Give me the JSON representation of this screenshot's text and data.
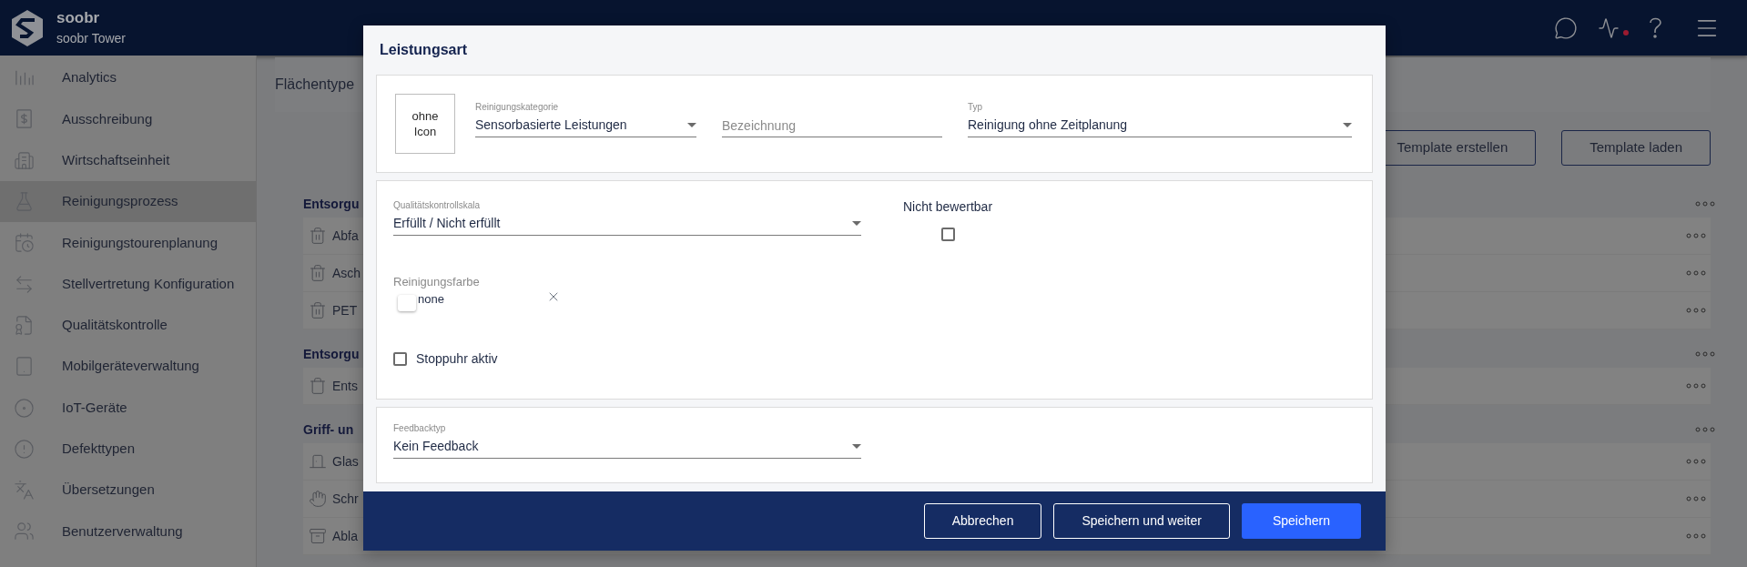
{
  "header": {
    "brand": "soobr",
    "site": "soobr Tower"
  },
  "sidebar": {
    "items": [
      {
        "label": "Analytics",
        "selected": false
      },
      {
        "label": "Ausschreibung",
        "selected": false
      },
      {
        "label": "Wirtschaftseinheit",
        "selected": false
      },
      {
        "label": "Reinigungsprozess",
        "selected": true
      },
      {
        "label": "Reinigungstourenplanung",
        "selected": false
      },
      {
        "label": "Stellvertretung Konfiguration",
        "selected": false
      },
      {
        "label": "Qualitätskontrolle",
        "selected": false
      },
      {
        "label": "Mobilgeräteverwaltung",
        "selected": false
      },
      {
        "label": "IoT-Geräte",
        "selected": false
      },
      {
        "label": "Defekttypen",
        "selected": false
      },
      {
        "label": "Übersetzungen",
        "selected": false
      },
      {
        "label": "Benutzerverwaltung",
        "selected": false
      }
    ]
  },
  "content": {
    "title": "Flächentype",
    "buttons": [
      "Template erstellen",
      "Template laden"
    ],
    "groups": [
      {
        "heading": "Entsorgu",
        "rows": [
          {
            "label": "Abfa"
          },
          {
            "label": "Asch"
          },
          {
            "label": "PET"
          }
        ]
      },
      {
        "heading": "Entsorgu",
        "rows": [
          {
            "label": "Ents"
          }
        ]
      },
      {
        "heading": "Griff- un",
        "rows": [
          {
            "label": "Glas"
          },
          {
            "label": "Schr"
          },
          {
            "label": "Abla"
          }
        ]
      }
    ]
  },
  "dialog": {
    "title": "Leistungsart",
    "icon_box": "ohne Icon",
    "category": {
      "label": "Reinigungskategorie",
      "value": "Sensorbasierte Leistungen"
    },
    "name": {
      "placeholder": "Bezeichnung"
    },
    "type": {
      "label": "Typ",
      "value": "Reinigung ohne Zeitplanung"
    },
    "quality": {
      "label": "Qualitätskontrollskala",
      "value": "Erfüllt / Nicht erfüllt"
    },
    "not_ratable": {
      "label": "Nicht bewertbar",
      "checked": false
    },
    "color": {
      "label": "Reinigungsfarbe",
      "value": "none"
    },
    "stopwatch": {
      "label": "Stoppuhr aktiv",
      "checked": false
    },
    "feedback": {
      "label": "Feedbacktyp",
      "value": "Kein Feedback"
    },
    "buttons": [
      {
        "label": "Abbrechen",
        "kind": "outline"
      },
      {
        "label": "Speichern und weiter",
        "kind": "outline"
      },
      {
        "label": "Speichern",
        "kind": "primary"
      }
    ]
  }
}
